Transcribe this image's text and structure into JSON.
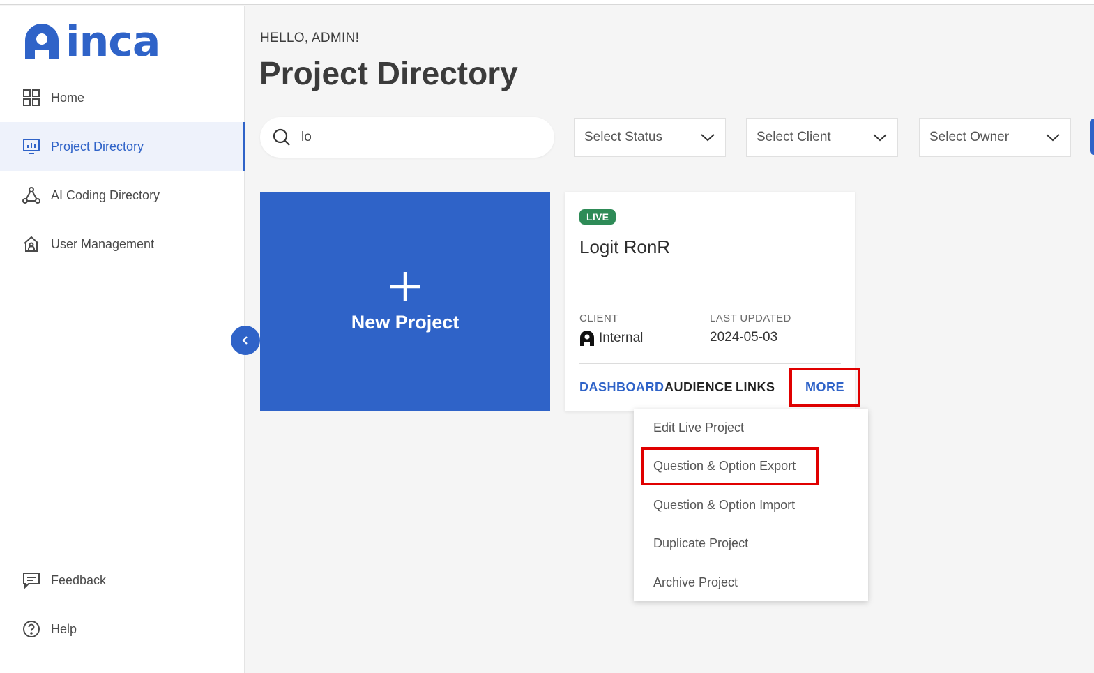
{
  "app": {
    "logo_text": "inca"
  },
  "sidebar": {
    "items": [
      {
        "label": "Home",
        "icon": "grid-icon"
      },
      {
        "label": "Project Directory",
        "icon": "chart-icon",
        "active": true
      },
      {
        "label": "AI Coding Directory",
        "icon": "network-icon"
      },
      {
        "label": "User Management",
        "icon": "house-icon"
      }
    ],
    "bottom_items": [
      {
        "label": "Feedback",
        "icon": "feedback-icon"
      },
      {
        "label": "Help",
        "icon": "help-icon"
      }
    ]
  },
  "header": {
    "greeting": "HELLO, ADMIN!",
    "title": "Project Directory"
  },
  "filters": {
    "search_value": "lo",
    "status_label": "Select Status",
    "client_label": "Select Client",
    "owner_label": "Select Owner"
  },
  "new_project": {
    "label": "New Project"
  },
  "project_card": {
    "status_badge": "LIVE",
    "name": "Logit RonR",
    "client_label": "CLIENT",
    "client_value": "Internal",
    "updated_label": "LAST UPDATED",
    "updated_value": "2024-05-03",
    "links": {
      "dashboard": "DASHBOARD",
      "audience": "AUDIENCE",
      "links": "LINKS",
      "more": "MORE"
    }
  },
  "more_menu": {
    "items": [
      "Edit Live Project",
      "Question & Option Export",
      "Question & Option Import",
      "Duplicate Project",
      "Archive Project"
    ]
  },
  "colors": {
    "brand": "#2f63c8",
    "live_badge": "#2e8b57",
    "highlight": "#e00000"
  }
}
